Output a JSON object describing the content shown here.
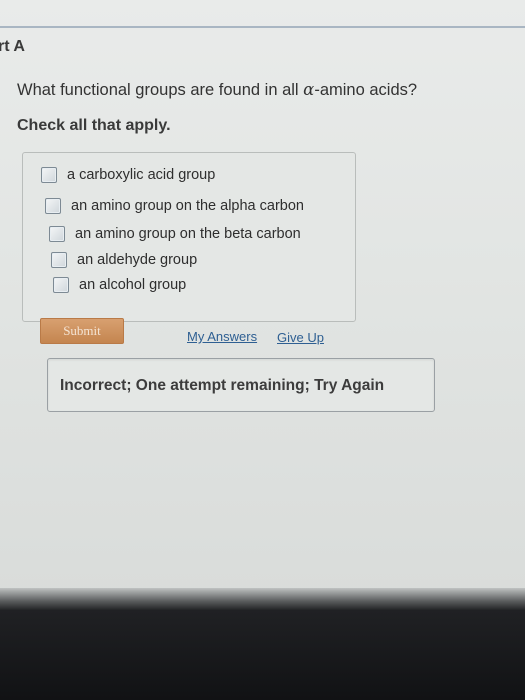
{
  "part": {
    "title": "rt A"
  },
  "question": {
    "text_before": "What functional groups are found in all ",
    "alpha_symbol": "α",
    "text_after": "-amino acids?",
    "instruction": "Check all that apply."
  },
  "options": [
    {
      "label": "a carboxylic acid group",
      "checked": false
    },
    {
      "label": "an amino group on the alpha carbon",
      "checked": false
    },
    {
      "label": "an amino group on the beta carbon",
      "checked": false
    },
    {
      "label": "an aldehyde group",
      "checked": false
    },
    {
      "label": "an alcohol group",
      "checked": false
    }
  ],
  "actions": {
    "submit_label": "Submit",
    "my_answers_label": "My Answers",
    "give_up_label": "Give Up"
  },
  "feedback": {
    "text": "Incorrect; One attempt remaining; Try Again"
  },
  "colors": {
    "submit_button": "#c98c58",
    "link": "#2e5f92",
    "page_background": "#e4e7e5"
  }
}
